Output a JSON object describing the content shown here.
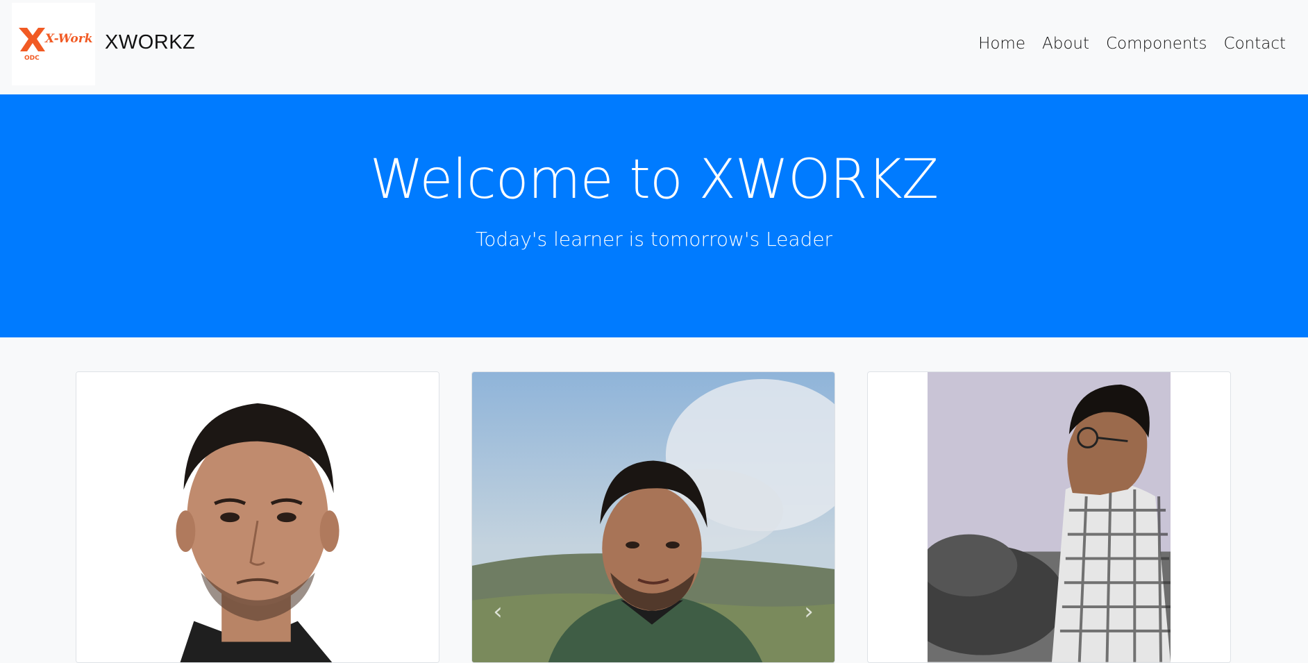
{
  "navbar": {
    "brand_name": "XWORKZ",
    "logo_text": "X-Workz",
    "logo_subtext": "ODC",
    "links": [
      {
        "label": "Home"
      },
      {
        "label": "About"
      },
      {
        "label": "Components"
      },
      {
        "label": "Contact"
      }
    ]
  },
  "hero": {
    "title": "Welcome to XWORKZ",
    "subtitle": "Today's learner is tomorrow's Leader",
    "background_color": "#007bff"
  },
  "cards": [
    {
      "photo": "person-portrait-photo"
    },
    {
      "photo": "person-outdoor-photo",
      "carousel": {
        "prev_icon": "‹",
        "next_icon": "›"
      }
    },
    {
      "photo": "person-side-profile-photo"
    }
  ],
  "colors": {
    "accent": "#007bff",
    "logo_orange": "#f15a24",
    "page_background": "#f8f9fa"
  }
}
